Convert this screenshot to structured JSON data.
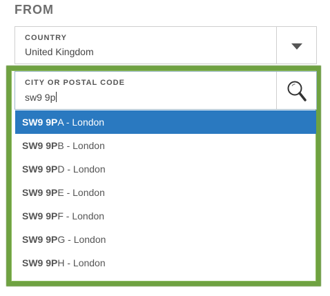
{
  "section_title": "FROM",
  "country": {
    "label": "COUNTRY",
    "value": "United Kingdom",
    "dropdown_icon": "chevron-down-icon"
  },
  "city": {
    "label": "CITY OR POSTAL CODE",
    "value": "sw9 9p",
    "search_icon": "search-icon"
  },
  "suggestions": [
    {
      "match": "SW9 9P",
      "rest": "A - London",
      "selected": true
    },
    {
      "match": "SW9 9P",
      "rest": "B - London",
      "selected": false
    },
    {
      "match": "SW9 9P",
      "rest": "D - London",
      "selected": false
    },
    {
      "match": "SW9 9P",
      "rest": "E - London",
      "selected": false
    },
    {
      "match": "SW9 9P",
      "rest": "F - London",
      "selected": false
    },
    {
      "match": "SW9 9P",
      "rest": "G - London",
      "selected": false
    },
    {
      "match": "SW9 9P",
      "rest": "H - London",
      "selected": false
    }
  ],
  "colors": {
    "selected_bg": "#2a79c0",
    "highlight_border": "#6fa241"
  }
}
